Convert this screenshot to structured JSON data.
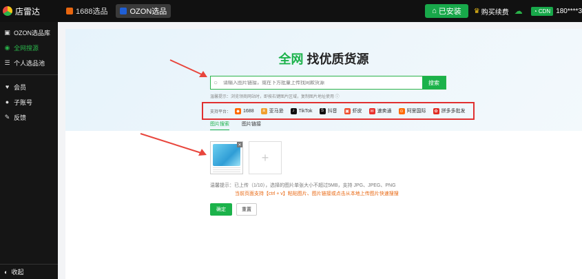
{
  "app": {
    "brand": "店雷达"
  },
  "tabs": [
    {
      "label": "1688选品",
      "color": "#e8660f"
    },
    {
      "label": "OZON选品",
      "color": "#1f5fd6"
    }
  ],
  "topright": {
    "installed": "已安装",
    "buy": "购买续费",
    "wifi": "CDN",
    "phone": "180****3"
  },
  "sidebar": {
    "items": [
      {
        "label": "OZON选品库",
        "icon": "box-icon"
      },
      {
        "label": "全网搜源",
        "icon": "search-icon"
      },
      {
        "label": "个人选品池",
        "icon": "list-icon"
      },
      {
        "label": "会员",
        "icon": "crown-icon"
      },
      {
        "label": "子账号",
        "icon": "user-icon"
      },
      {
        "label": "反馈",
        "icon": "feedback-icon"
      }
    ],
    "collapse": "收起"
  },
  "hero": {
    "headline_green": "全网",
    "headline_rest": "找优质货源",
    "search_placeholder": "请输入图片链接，或在下方批量上传找同款货源",
    "search_button": "搜索",
    "tip": "温馨提示：浏览领商网站时，即按右键图片区域，复制图片地址使用 ⓘ"
  },
  "platforms": {
    "label": "支持平台：",
    "items": [
      {
        "label": "1688",
        "color": "#ff6a00"
      },
      {
        "label": "亚马逊",
        "color": "#f0a030"
      },
      {
        "label": "TikTok",
        "color": "#111111"
      },
      {
        "label": "抖音",
        "color": "#111111"
      },
      {
        "label": "虾皮",
        "color": "#ee4d2d"
      },
      {
        "label": "速卖通",
        "color": "#e8312c"
      },
      {
        "label": "阿里国际",
        "color": "#ff6a00"
      },
      {
        "label": "拼多多批发",
        "color": "#e02e24"
      }
    ]
  },
  "search_tabs": [
    "图片搜索",
    "图片链接"
  ],
  "upload": {
    "hint1": "温馨提示：已上传（1/10），选择的图片单张大小不超过5MB，支持 JPG、JPEG、PNG",
    "hint2": "当前页面支持【ctrl + v】粘贴图片、图片链接或点击从本地上传图片快速搜搜"
  },
  "buttons": {
    "ok": "确定",
    "reset": "重置"
  }
}
